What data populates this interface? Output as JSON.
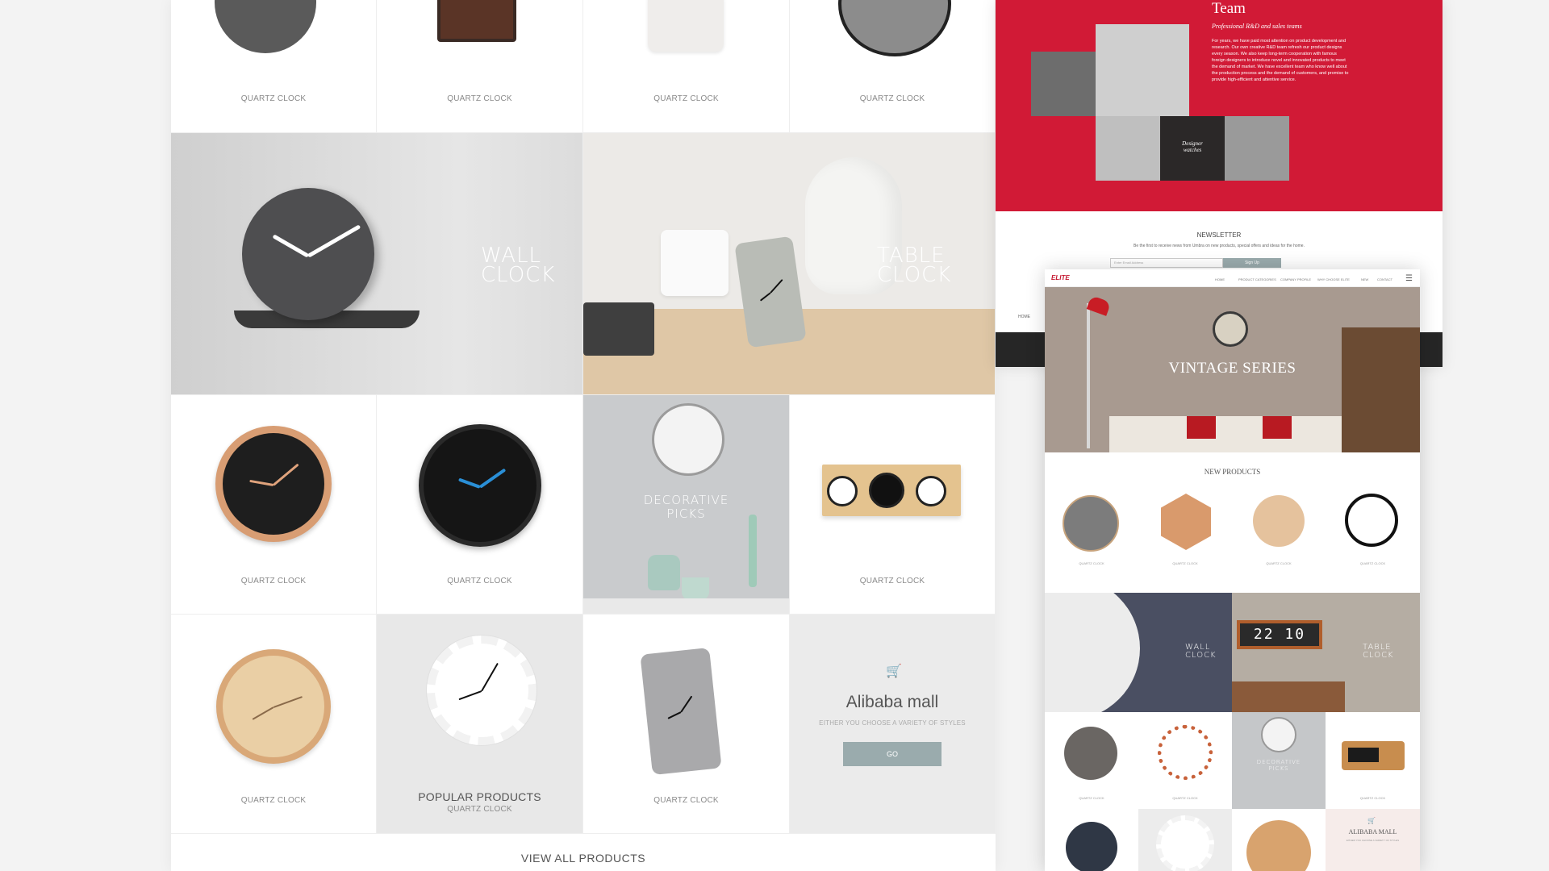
{
  "main": {
    "top_captions": [
      "QUARTZ CLOCK",
      "QUARTZ CLOCK",
      "QUARTZ CLOCK",
      "QUARTZ CLOCK"
    ],
    "wall_clock_label": "WALL\nCLOCK",
    "table_clock_label": "TABLE\nCLOCK",
    "row3_captions": [
      "QUARTZ CLOCK",
      "QUARTZ CLOCK",
      "QUARTZ CLOCK"
    ],
    "decorative_label": "DECORATIVE\nPICKS",
    "row4_captions": [
      "QUARTZ CLOCK",
      "QUARTZ CLOCK"
    ],
    "popular_title": "POPULAR PRODUCTS",
    "popular_sub": "QUARTZ CLOCK",
    "mall_title": "Alibaba mall",
    "mall_sub": "EITHER YOU CHOOSE A VARIETY OF STYLES",
    "mall_button": "GO",
    "view_all": "VIEW ALL PRODUCTS"
  },
  "back_page": {
    "team_title": "Team",
    "team_subtitle": "Professional R&D and sales teams",
    "team_body": "For years, we have paid most attention on product development and research. Our own creative R&D team refresh our product designs every season. We also keep long-term cooperation with famous foreign designers to introduce novel and innovated products to meet the demand of market. We have excellent team who know well about the production process and the demand of customers, and promise to provide high-efficient and attentive service.",
    "designer_label": "Designer\nwatches",
    "newsletter_title": "NEWSLETTER",
    "newsletter_text": "Be the first to receive news from Umbra on new products, special offers and ideas for the home.",
    "email_placeholder": "Enter Email Address",
    "signup_button": "Sign Up",
    "home_link": "HOME"
  },
  "front_page": {
    "logo": "ELITE",
    "nav": [
      "HOME",
      "PRODUCT CATEGORIES",
      "COMPANY PROFILE",
      "WHY CHOOSE ELITE",
      "NEW",
      "CONTACT"
    ],
    "hero_title": "VINTAGE SERIES",
    "new_products_title": "NEW PRODUCTS",
    "product_captions": [
      "QUARTZ CLOCK",
      "QUARTZ CLOCK",
      "QUARTZ CLOCK",
      "QUARTZ CLOCK"
    ],
    "wall_clock_label": "WALL\nCLOCK",
    "table_clock_label": "TABLE\nCLOCK",
    "flip_clock_time": "22 10",
    "row_captions": [
      "QUARTZ CLOCK",
      "QUARTZ CLOCK",
      "QUARTZ CLOCK"
    ],
    "decorative_label": "DECORATIVE\nPICKS",
    "mall_title": "ALIBABA MALL",
    "mall_sub": "EITHER YOU CHOOSE A VARIETY OF STYLES"
  },
  "colors": {
    "brand_red": "#d11a36",
    "button_slate": "#9aabad",
    "blue_hands": "#2a8fd6"
  }
}
